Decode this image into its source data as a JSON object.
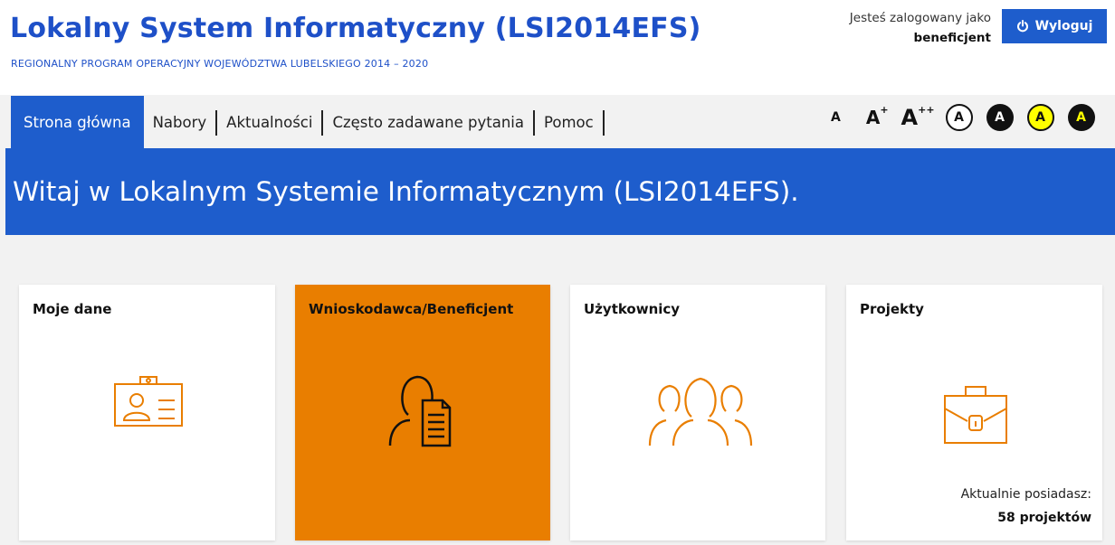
{
  "header": {
    "title": "Lokalny System Informatyczny (LSI2014EFS)",
    "subtitle": "REGIONALNY PROGRAM OPERACYJNY WOJEWÓDZTWA LUBELSKIEGO 2014 – 2020",
    "login_label": "Jesteś zalogowany jako",
    "login_role": "beneficjent",
    "logout_label": "Wyloguj"
  },
  "nav": [
    {
      "label": "Strona główna",
      "active": true
    },
    {
      "label": "Nabory"
    },
    {
      "label": "Aktualności"
    },
    {
      "label": "Często zadawane pytania"
    },
    {
      "label": "Pomoc"
    }
  ],
  "accessibility": {
    "font_normal": "A",
    "font_large": "A",
    "font_large_sup": "+",
    "font_xlarge": "A",
    "font_xlarge_sup": "++",
    "contrast_labels": [
      "A",
      "A",
      "A",
      "A"
    ]
  },
  "banner": {
    "text": "Witaj w Lokalnym Systemie Informatycznym (LSI2014EFS)."
  },
  "tiles": [
    {
      "title": "Moje dane",
      "icon": "id-card-icon"
    },
    {
      "title": "Wnioskodawca/Beneficjent",
      "icon": "applicant-document-icon",
      "active": true
    },
    {
      "title": "Użytkownicy",
      "icon": "users-icon"
    },
    {
      "title": "Projekty",
      "icon": "briefcase-icon",
      "info_label": "Aktualnie posiadasz:",
      "info_value": "58 projektów"
    }
  ],
  "colors": {
    "brand_blue": "#1e5dcc",
    "title_blue": "#1e50c8",
    "accent_orange": "#e97e00",
    "contrast_yellow": "#ffff00"
  }
}
